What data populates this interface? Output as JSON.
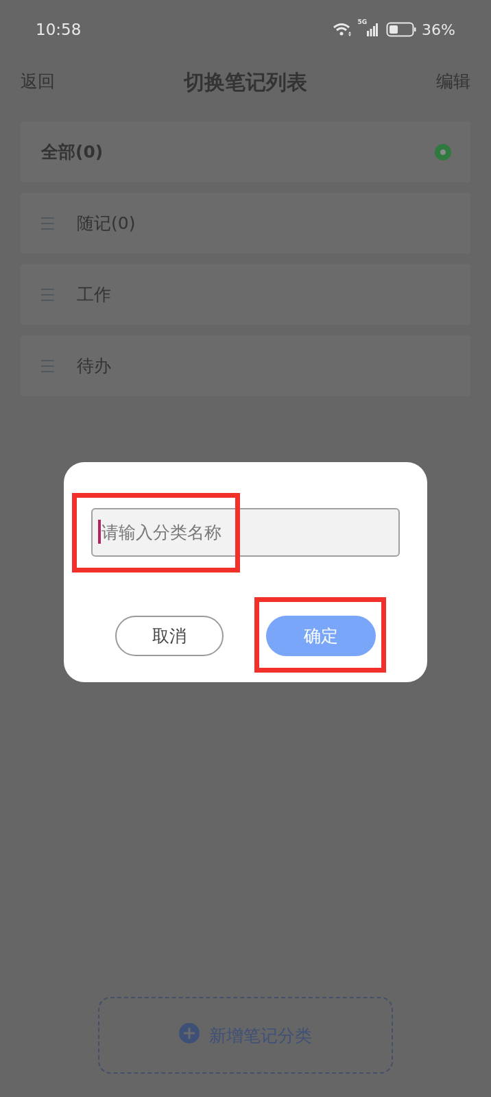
{
  "status_bar": {
    "time": "10:58",
    "network": "5G",
    "battery": "36%"
  },
  "header": {
    "back": "返回",
    "title": "切换笔记列表",
    "edit": "编辑"
  },
  "categories": [
    {
      "kind": "all",
      "label": "全部(0)",
      "selected": true
    },
    {
      "kind": "category",
      "label": "随记(0)",
      "selected": false
    },
    {
      "kind": "category",
      "label": "工作",
      "selected": false
    },
    {
      "kind": "category",
      "label": "待办",
      "selected": false
    }
  ],
  "add_button": "新增笔记分类",
  "dialog": {
    "input": {
      "placeholder": "请输入分类名称",
      "focused": true
    },
    "cancel": "取消",
    "confirm": "确定"
  }
}
